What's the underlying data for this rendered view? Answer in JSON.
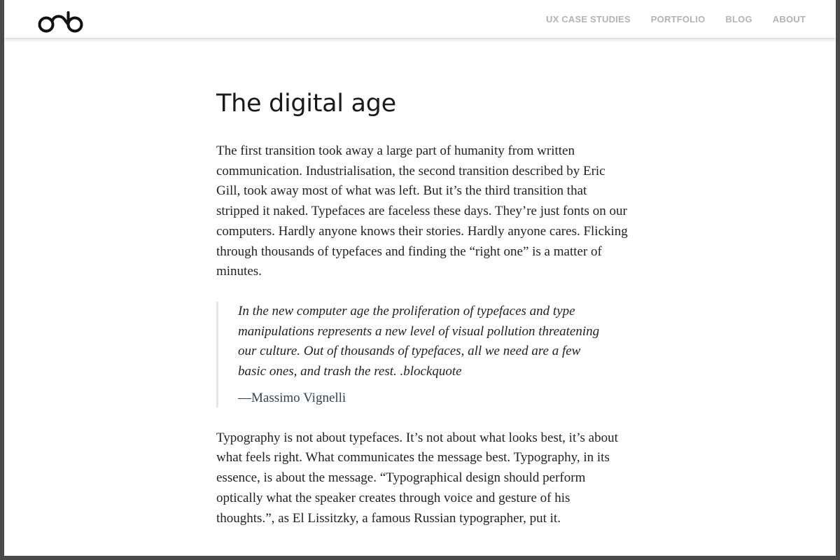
{
  "header": {
    "logo_icon": "orb-logo-icon",
    "nav": [
      {
        "label": "UX CASE STUDIES"
      },
      {
        "label": "PORTFOLIO"
      },
      {
        "label": "BLOG"
      },
      {
        "label": "ABOUT"
      }
    ]
  },
  "article": {
    "title": "The digital age",
    "paragraph_1": "The first transition took away a large part of humanity from written communication. Industrialisation, the second transition described by Eric Gill, took away most of what was left. But it’s the third transition that stripped it naked. Typefaces are faceless these days. They’re just fonts on our computers. Hardly anyone knows their stories. Hardly anyone cares. Flicking through thousands of typefaces and finding the “right one” is a matter of minutes.",
    "quote_text": "In the new computer age the proliferation of typefaces and type manipulations represents a new level of visual pollution threatening our culture. Out of thousands of typefaces, all we need are a few basic ones, and trash the rest. .blockquote",
    "quote_author": "—Massimo Vignelli",
    "paragraph_2": "Typography is not about typefaces. It’s not about what looks best, it’s about what feels right. What communicates the message best. Typography, in its essence, is about the message. “Typographical design should perform optically what the speaker creates through voice and gesture of his thoughts.”, as El Lissitzky, a famous Russian typographer, put it."
  },
  "colors": {
    "nav_text": "#b3b3b3",
    "body_text": "#222222",
    "quote_author": "#34424d",
    "frame": "#4a4a4a"
  }
}
